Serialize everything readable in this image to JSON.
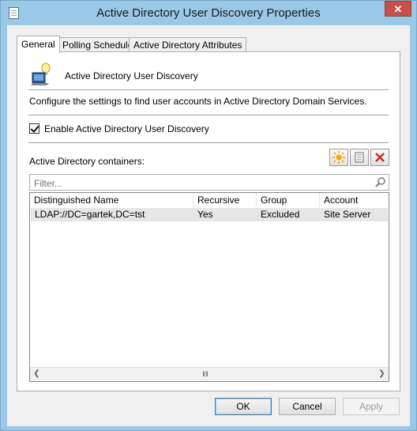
{
  "window": {
    "title": "Active Directory User Discovery Properties",
    "close_glyph": "✕"
  },
  "tabs": [
    {
      "label": "General",
      "active": true
    },
    {
      "label": "Polling Schedule",
      "active": false
    },
    {
      "label": "Active Directory Attributes",
      "active": false
    }
  ],
  "general": {
    "heading": "Active Directory User Discovery",
    "description": "Configure the settings to find user accounts in Active Directory Domain Services.",
    "enable_label": "Enable Active Directory User Discovery",
    "enable_checked": true,
    "containers_label": "Active Directory containers:",
    "toolbar": {
      "new_icon": "new-star-icon",
      "properties_icon": "properties-icon",
      "delete_icon": "delete-x-icon"
    },
    "filter": {
      "placeholder": "Filter..."
    },
    "grid": {
      "columns": [
        "Distinguished Name",
        "Recursive",
        "Group",
        "Account"
      ],
      "rows": [
        {
          "dn": "LDAP://DC=gartek,DC=tst",
          "recursive": "Yes",
          "group": "Excluded",
          "account": "Site Server"
        }
      ]
    }
  },
  "buttons": {
    "ok": "OK",
    "cancel": "Cancel",
    "apply": "Apply"
  },
  "colors": {
    "title_bar": "#99c8e8",
    "close_button": "#c7504b",
    "selected_row": "#e6e6e6"
  }
}
